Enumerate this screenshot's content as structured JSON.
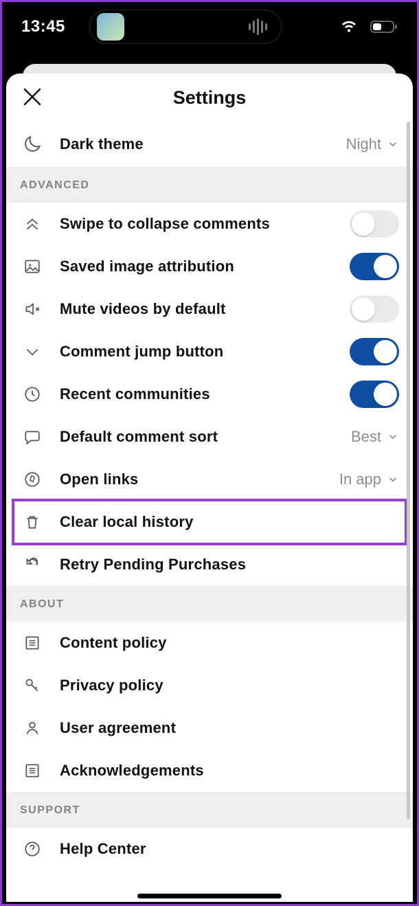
{
  "status": {
    "time": "13:45"
  },
  "header": {
    "title": "Settings"
  },
  "rows": {
    "dark": {
      "label": "Dark theme",
      "value": "Night"
    },
    "swipe": {
      "label": "Swipe to collapse comments"
    },
    "attr": {
      "label": "Saved image attribution"
    },
    "mute": {
      "label": "Mute videos by default"
    },
    "jump": {
      "label": "Comment jump button"
    },
    "recent": {
      "label": "Recent communities"
    },
    "sort": {
      "label": "Default comment sort",
      "value": "Best"
    },
    "links": {
      "label": "Open links",
      "value": "In app"
    },
    "clear": {
      "label": "Clear local history"
    },
    "retry": {
      "label": "Retry Pending Purchases"
    },
    "content": {
      "label": "Content policy"
    },
    "privacy": {
      "label": "Privacy policy"
    },
    "agree": {
      "label": "User agreement"
    },
    "ack": {
      "label": "Acknowledgements"
    },
    "help": {
      "label": "Help Center"
    }
  },
  "sections": {
    "advanced": "ADVANCED",
    "about": "ABOUT",
    "support": "SUPPORT"
  },
  "toggles": {
    "swipe": false,
    "attr": true,
    "mute": false,
    "jump": true,
    "recent": true
  }
}
